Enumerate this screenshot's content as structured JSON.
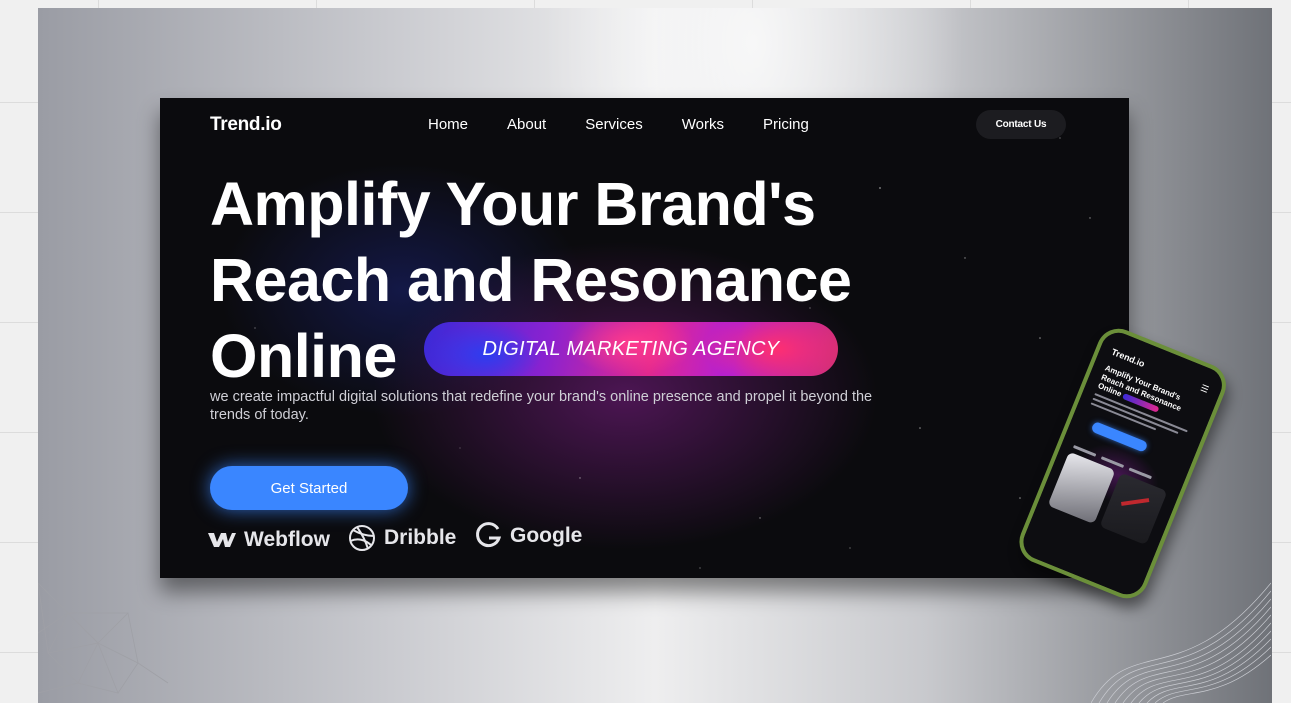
{
  "site": {
    "logo": "Trend.io",
    "nav": [
      "Home",
      "About",
      "Services",
      "Works",
      "Pricing"
    ],
    "contact_label": "Contact Us"
  },
  "hero": {
    "title_lines": [
      "Amplify Your Brand's",
      "Reach and Resonance",
      "Online"
    ],
    "badge": "DIGITAL MARKETING AGENCY",
    "subtitle": "we create impactful digital solutions that redefine your brand's online presence and propel it beyond the trends of today.",
    "cta_label": "Get Started"
  },
  "partners": [
    {
      "name": "Webflow",
      "icon": "webflow-icon"
    },
    {
      "name": "Dribble",
      "icon": "dribbble-icon"
    },
    {
      "name": "Google",
      "icon": "google-icon"
    }
  ],
  "phone": {
    "logo": "Trend.io",
    "menu_icon": "hamburger-icon",
    "title": "Amplify Your Brand's Reach and Resonance Online",
    "cta_label": "Get Started"
  },
  "colors": {
    "accent": "#3a86ff",
    "background_dark": "#0b0b0e",
    "phone_frame": "#6b8f3a"
  }
}
